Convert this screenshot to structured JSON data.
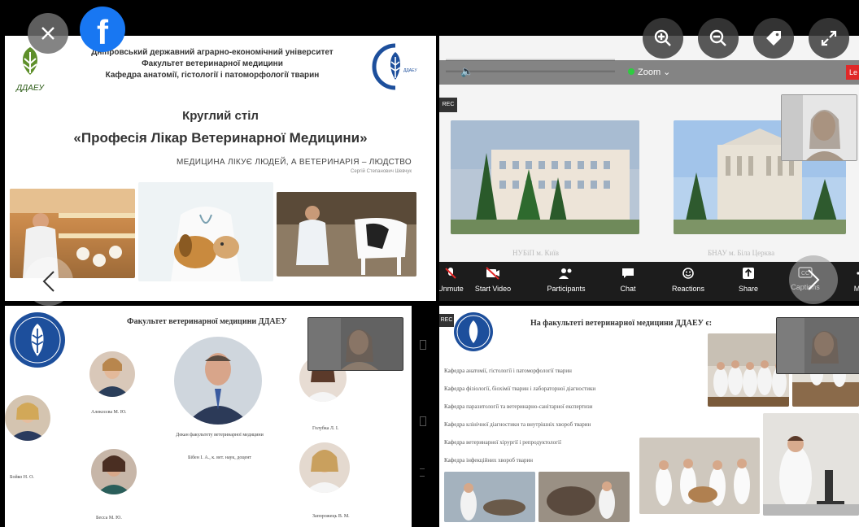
{
  "viewer": {
    "close_icon": "close-icon",
    "facebook_icon": "facebook-icon",
    "zoom_in_icon": "zoom-in-icon",
    "zoom_out_icon": "zoom-out-icon",
    "tag_icon": "tag-icon",
    "fullscreen_icon": "fullscreen-icon",
    "prev_icon": "chevron-left-icon",
    "next_icon": "chevron-right-icon"
  },
  "slide1": {
    "university": "Дніпровський державний аграрно-економічний університет",
    "faculty": "Факультет ветеринарної медицини",
    "department": "Кафедра анатомії, гістології і патоморфології тварин",
    "logo_text": "ДДАЕУ",
    "event": "Круглий стіл",
    "title": "«Професія Лікар Ветеринарної Медицини»",
    "quote": "МЕДИЦИНА ЛІКУЄ ЛЮДЕЙ, А ВЕТЕРИНАРІЯ – ЛЮДСТВО",
    "quote_author": "Сергій Степанович Шевчук"
  },
  "zoom": {
    "rec_label": "REC",
    "zoom_label": "Zoom",
    "leave_label": "Le",
    "caption_left": "НУБіП м. Київ",
    "caption_right": "БНАУ м. Біла Церква",
    "toolbar": [
      {
        "label": "Unmute",
        "icon": "microphone-icon"
      },
      {
        "label": "Start Video",
        "icon": "video-off-icon"
      },
      {
        "label": "Participants",
        "icon": "participants-icon"
      },
      {
        "label": "Chat",
        "icon": "chat-icon"
      },
      {
        "label": "Reactions",
        "icon": "reactions-icon"
      },
      {
        "label": "Share",
        "icon": "share-icon"
      },
      {
        "label": "Captions",
        "icon": "captions-icon"
      },
      {
        "label": "More",
        "icon": "more-icon"
      }
    ]
  },
  "slide3": {
    "title": "Факультет ветеринарної медицини ДДАЕУ",
    "dean_caption": "Декан факультету ветеринарної медицини",
    "dean_name": "Бібен І. А., к. вет. наук, доцент",
    "people": [
      "Алексєєва М. Ю.",
      "Бойко Н. О.",
      "Бесса М. Ю.",
      "Голубка Л. І.",
      "Запорожець В. М."
    ]
  },
  "slide4": {
    "rec_label": "REC",
    "title": "На факультеті ветеринарної медицини ДДАЕУ є:",
    "departments": [
      "Кафедра анатомії, гістології і патоморфології тварин",
      "Кафедра фізіології, біохімії тварин і лабораторної діагностики",
      "Кафедра паразитології та ветеринарно-санітарної експертизи",
      "Кафедра клінічної діагностики та внутрішніх хвороб тварин",
      "Кафедра ветеринарної хірургії і репродуктології",
      "Кафедра інфекційних хвороб тварин"
    ]
  },
  "colors": {
    "facebook": "#1877f2",
    "zoom_green": "#2ecc40",
    "logo_blue": "#1d4f9c",
    "leave_red": "#e02828"
  }
}
